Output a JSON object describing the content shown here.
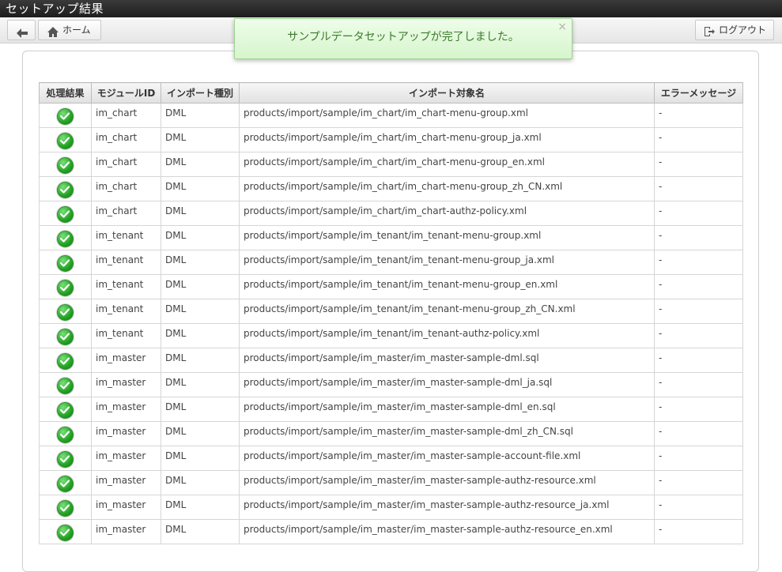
{
  "window": {
    "title": "セットアップ結果"
  },
  "toolbar": {
    "home_label": "ホーム",
    "logout_label": "ログアウト"
  },
  "notification": {
    "message": "サンプルデータセットアップが完了しました。",
    "close": "×"
  },
  "table": {
    "headers": [
      "処理結果",
      "モジュールID",
      "インポート種別",
      "インポート対象名",
      "エラーメッセージ"
    ],
    "rows": [
      {
        "module": "im_chart",
        "type": "DML",
        "target": "products/import/sample/im_chart/im_chart-menu-group.xml",
        "error": "-"
      },
      {
        "module": "im_chart",
        "type": "DML",
        "target": "products/import/sample/im_chart/im_chart-menu-group_ja.xml",
        "error": "-"
      },
      {
        "module": "im_chart",
        "type": "DML",
        "target": "products/import/sample/im_chart/im_chart-menu-group_en.xml",
        "error": "-"
      },
      {
        "module": "im_chart",
        "type": "DML",
        "target": "products/import/sample/im_chart/im_chart-menu-group_zh_CN.xml",
        "error": "-"
      },
      {
        "module": "im_chart",
        "type": "DML",
        "target": "products/import/sample/im_chart/im_chart-authz-policy.xml",
        "error": "-"
      },
      {
        "module": "im_tenant",
        "type": "DML",
        "target": "products/import/sample/im_tenant/im_tenant-menu-group.xml",
        "error": "-"
      },
      {
        "module": "im_tenant",
        "type": "DML",
        "target": "products/import/sample/im_tenant/im_tenant-menu-group_ja.xml",
        "error": "-"
      },
      {
        "module": "im_tenant",
        "type": "DML",
        "target": "products/import/sample/im_tenant/im_tenant-menu-group_en.xml",
        "error": "-"
      },
      {
        "module": "im_tenant",
        "type": "DML",
        "target": "products/import/sample/im_tenant/im_tenant-menu-group_zh_CN.xml",
        "error": "-"
      },
      {
        "module": "im_tenant",
        "type": "DML",
        "target": "products/import/sample/im_tenant/im_tenant-authz-policy.xml",
        "error": "-"
      },
      {
        "module": "im_master",
        "type": "DML",
        "target": "products/import/sample/im_master/im_master-sample-dml.sql",
        "error": "-"
      },
      {
        "module": "im_master",
        "type": "DML",
        "target": "products/import/sample/im_master/im_master-sample-dml_ja.sql",
        "error": "-"
      },
      {
        "module": "im_master",
        "type": "DML",
        "target": "products/import/sample/im_master/im_master-sample-dml_en.sql",
        "error": "-"
      },
      {
        "module": "im_master",
        "type": "DML",
        "target": "products/import/sample/im_master/im_master-sample-dml_zh_CN.sql",
        "error": "-"
      },
      {
        "module": "im_master",
        "type": "DML",
        "target": "products/import/sample/im_master/im_master-sample-account-file.xml",
        "error": "-"
      },
      {
        "module": "im_master",
        "type": "DML",
        "target": "products/import/sample/im_master/im_master-sample-authz-resource.xml",
        "error": "-"
      },
      {
        "module": "im_master",
        "type": "DML",
        "target": "products/import/sample/im_master/im_master-sample-authz-resource_ja.xml",
        "error": "-"
      },
      {
        "module": "im_master",
        "type": "DML",
        "target": "products/import/sample/im_master/im_master-sample-authz-resource_en.xml",
        "error": "-"
      }
    ]
  },
  "icons": {
    "back": "arrow-left-icon",
    "home": "home-icon",
    "logout": "logout-icon",
    "status": "check-circle-icon",
    "close": "close-icon"
  },
  "colors": {
    "titlebar": "#262626",
    "toast_bg": "#e3f9dc",
    "toast_text": "#3d7a2d",
    "success": "#22a322"
  }
}
